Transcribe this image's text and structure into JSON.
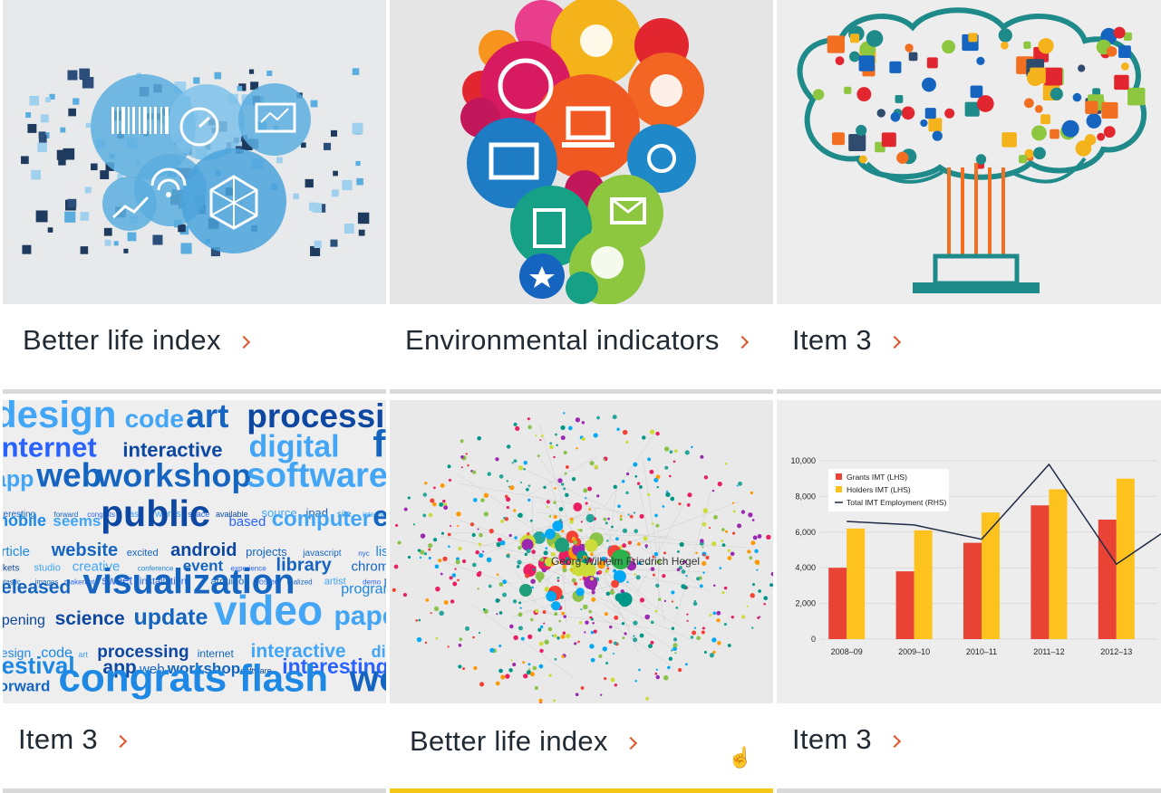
{
  "cards": [
    {
      "title": "Better life index",
      "image": "data-visualization-circles",
      "active": false
    },
    {
      "title": "Environmental indicators",
      "image": "social-media-icons-bulb",
      "active": false
    },
    {
      "title": "Item 3",
      "image": "technology-icon-tree",
      "active": false
    },
    {
      "title": "Item 3",
      "image": "programming-word-cloud",
      "active": false
    },
    {
      "title": "Better life index",
      "image": "network-graph",
      "active": true
    },
    {
      "title": "Item 3",
      "image": "bar-line-chart",
      "active": false
    }
  ],
  "network_label": "Georg Wilhelm Friedrich Hegel",
  "word_cloud": [
    "design",
    "code",
    "art",
    "processing",
    "internet",
    "interactive",
    "digital",
    "festival",
    "app",
    "web",
    "workshop",
    "software",
    "interesting",
    "forward",
    "congrats",
    "flash",
    "works",
    "space",
    "available",
    "source",
    "ipad",
    "site",
    "interview",
    "mobile",
    "seems",
    "public",
    "based",
    "computer",
    "email",
    "article",
    "website",
    "excited",
    "android",
    "projects",
    "javascript",
    "nyc",
    "list",
    "tickets",
    "studio",
    "creative",
    "conference",
    "event",
    "experience",
    "library",
    "chrome",
    "fantastic",
    "images",
    "makerbot",
    "sweet",
    "installation",
    "arduino",
    "posted",
    "realized",
    "artist",
    "demo",
    "problem",
    "released",
    "visualization",
    "programming",
    "opening",
    "science",
    "update",
    "video",
    "papers"
  ],
  "chart_data": {
    "type": "bar",
    "categories": [
      "2008–09",
      "2009–10",
      "2010–11",
      "2011–12",
      "2012–13"
    ],
    "series": [
      {
        "name": "Grants IMT (LHS)",
        "type": "bar",
        "color": "#e94335",
        "values": [
          4000,
          3800,
          5400,
          7500,
          6700
        ]
      },
      {
        "name": "Holders IMT (LHS)",
        "type": "bar",
        "color": "#fdc21e",
        "values": [
          6200,
          6100,
          7100,
          8400,
          9000
        ]
      },
      {
        "name": "Total IMT Employment (RHS)",
        "type": "line",
        "color": "#1f2a44",
        "values": [
          6600,
          6400,
          5600,
          9800,
          4200
        ]
      }
    ],
    "ylim": [
      0,
      10000
    ],
    "yticks": [
      "10,000",
      "8,000",
      "6,000",
      "4,000",
      "2,000",
      "0"
    ],
    "legend": "top-left"
  }
}
